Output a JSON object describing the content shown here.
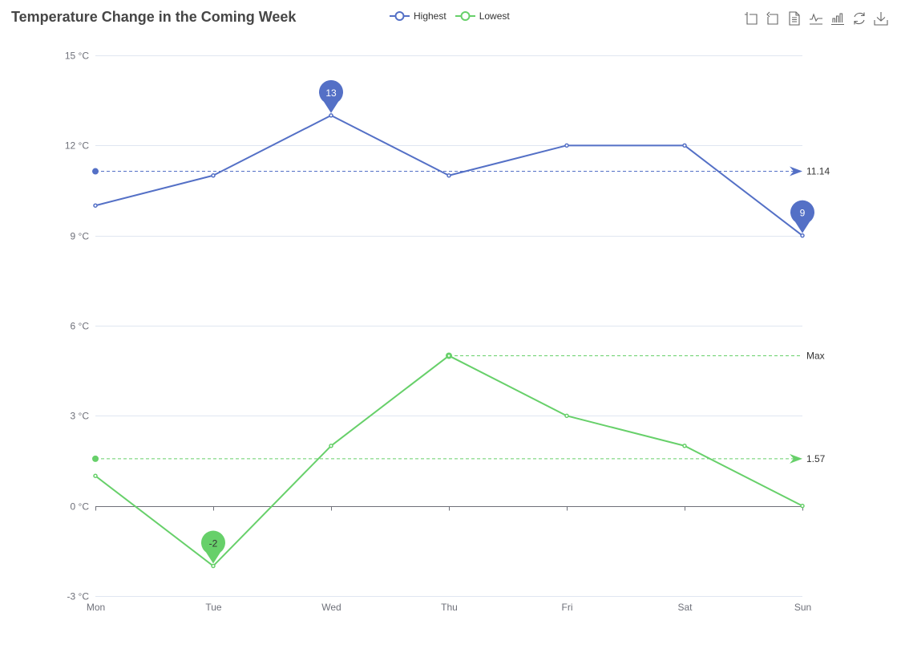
{
  "chart_data": {
    "type": "line",
    "title": "Temperature Change in the Coming Week",
    "categories": [
      "Mon",
      "Tue",
      "Wed",
      "Thu",
      "Fri",
      "Sat",
      "Sun"
    ],
    "y_tick_values": [
      -3,
      0,
      3,
      6,
      9,
      12,
      15
    ],
    "y_tick_suffix": " °C",
    "ylim": [
      -3,
      15
    ],
    "grid": true,
    "legend_position": "top-center",
    "xlabel": "",
    "ylabel": "",
    "series": [
      {
        "name": "Highest",
        "color": "#5470c6",
        "values": [
          10,
          11,
          13,
          11,
          12,
          12,
          9
        ],
        "mark_points": [
          {
            "type": "max",
            "index": 2,
            "value": 13,
            "label": "13"
          },
          {
            "type": "min",
            "index": 6,
            "value": 9,
            "label": "9"
          }
        ],
        "mark_lines": [
          {
            "type": "average",
            "value": 11.14,
            "label": "11.14",
            "arrow": true
          }
        ]
      },
      {
        "name": "Lowest",
        "color": "#67d06a",
        "values": [
          1,
          -2,
          2,
          5,
          3,
          2,
          0
        ],
        "mark_points": [
          {
            "type": "min",
            "index": 1,
            "value": -2,
            "label": "-2"
          }
        ],
        "mark_lines": [
          {
            "type": "average",
            "value": 1.57,
            "label": "1.57",
            "arrow": true
          },
          {
            "type": "max",
            "value": 5,
            "from_index": 3,
            "label": "Max",
            "arrow": false
          }
        ]
      }
    ]
  },
  "toolbox": {
    "items": [
      {
        "name": "data-zoom-icon",
        "tooltip": "Zoom"
      },
      {
        "name": "zoom-reset-icon",
        "tooltip": "Zoom Reset"
      },
      {
        "name": "data-view-icon",
        "tooltip": "Data View"
      },
      {
        "name": "line-chart-icon",
        "tooltip": "Switch to Line Chart"
      },
      {
        "name": "bar-chart-icon",
        "tooltip": "Switch to Bar Chart"
      },
      {
        "name": "restore-icon",
        "tooltip": "Restore"
      },
      {
        "name": "save-image-icon",
        "tooltip": "Save as Image"
      }
    ]
  }
}
